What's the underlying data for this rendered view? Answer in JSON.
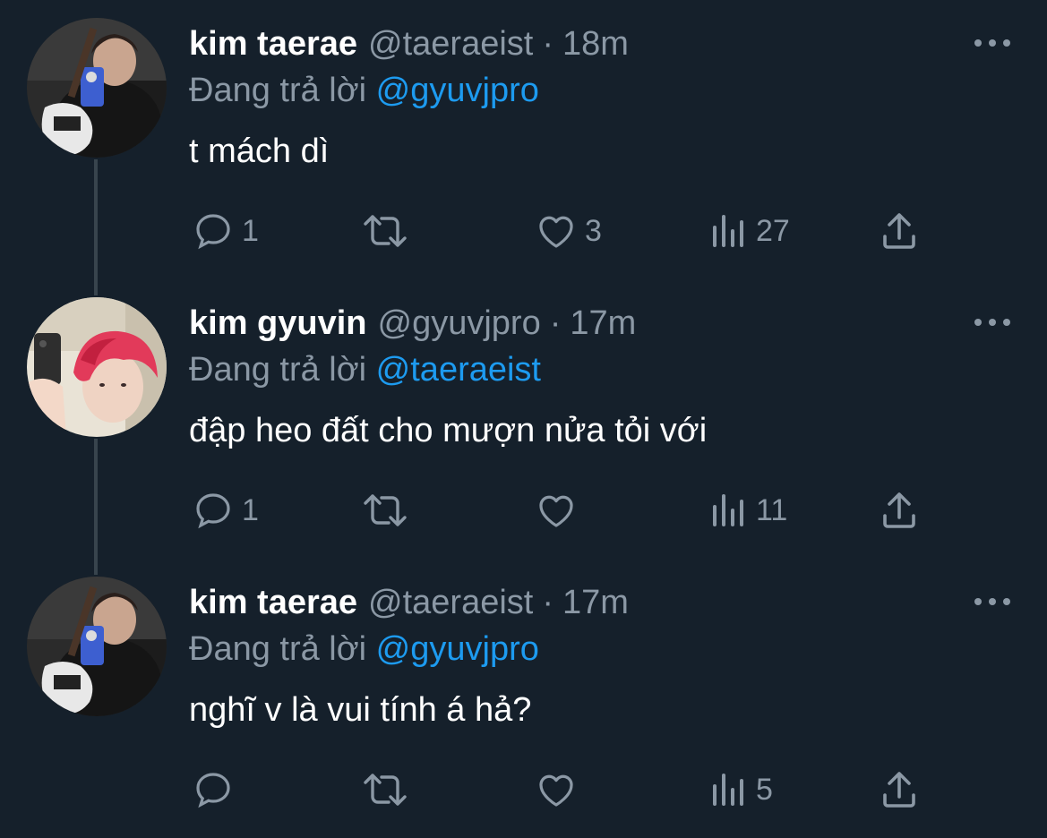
{
  "colors": {
    "background": "#15202b",
    "secondary_text": "#8b98a5",
    "mention": "#1d9bf0",
    "thread_line": "#38444d"
  },
  "icons": [
    "reply-icon",
    "retweet-icon",
    "like-icon",
    "views-icon",
    "share-icon",
    "more-icon"
  ],
  "tweets": [
    {
      "name": "kim taerae",
      "handle": "@taeraeist",
      "separator": "·",
      "time": "18m",
      "reply_prefix": "Đang trả lời",
      "reply_to": "@gyuvjpro",
      "text": "t mách dì",
      "replies": "1",
      "retweets": "",
      "likes": "3",
      "views": "27"
    },
    {
      "name": "kim gyuvin",
      "handle": "@gyuvjpro",
      "separator": "·",
      "time": "17m",
      "reply_prefix": "Đang trả lời",
      "reply_to": "@taeraeist",
      "text": "đập heo đất cho mượn nửa tỏi với",
      "replies": "1",
      "retweets": "",
      "likes": "",
      "views": "11"
    },
    {
      "name": "kim taerae",
      "handle": "@taeraeist",
      "separator": "·",
      "time": "17m",
      "reply_prefix": "Đang trả lời",
      "reply_to": "@gyuvjpro",
      "text": "nghĩ v là vui tính á hả?",
      "replies": "",
      "retweets": "",
      "likes": "",
      "views": "5"
    }
  ]
}
